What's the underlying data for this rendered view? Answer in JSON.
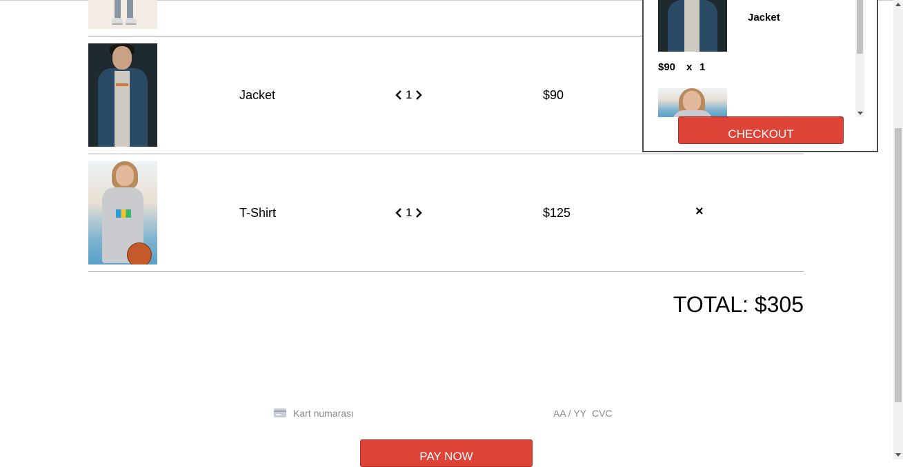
{
  "cart": {
    "rows": [
      {
        "name": "Jacket",
        "qty": "1",
        "price": "$90",
        "image_icon": "jacket-photo"
      },
      {
        "name": "T-Shirt",
        "qty": "1",
        "price": "$125",
        "image_icon": "tshirt-photo"
      }
    ],
    "remove_symbol": "×",
    "total_label": "TOTAL: $305"
  },
  "payment": {
    "card_placeholder": "Kart numarası",
    "expiry_placeholder": "AA / YY",
    "cvc_placeholder": "CVC",
    "pay_label": "PAY NOW"
  },
  "mini_cart": {
    "items": [
      {
        "name": "Jacket",
        "price": "$90",
        "times": "x",
        "qty": "1"
      }
    ],
    "checkout_label": "CHECKOUT"
  },
  "colors": {
    "accent_red": "#dd4437",
    "divider": "#a8a8a8"
  }
}
